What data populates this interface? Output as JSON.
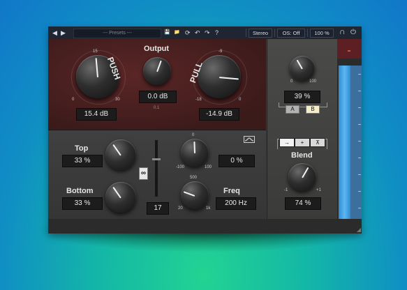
{
  "toolbar": {
    "prev_icon": "◀",
    "next_icon": "▶",
    "presets_label": "--- Presets ---",
    "save_icon": "💾",
    "folder_icon": "📁",
    "reload_icon": "⟳",
    "undo_icon": "↶",
    "redo_icon": "↷",
    "help_icon": "?",
    "stereo_label": "Stereo",
    "os_label": "OS: Off",
    "zoom_label": "100 %",
    "headphones_icon": "∩",
    "power_icon": "⏻"
  },
  "upper": {
    "push": {
      "label": "PUSH",
      "value": "15.4 dB",
      "scale_min": "0",
      "scale_mid": "15",
      "scale_max": "30"
    },
    "output": {
      "label": "Output",
      "value": "0.0 dB",
      "sublabel": "0.1"
    },
    "pull": {
      "label": "PULL",
      "value": "-14.9 dB",
      "scale_min": "-18",
      "scale_mid": "-9",
      "scale_max": "0"
    }
  },
  "lower": {
    "top": {
      "label": "Top",
      "value": "33 %"
    },
    "bottom": {
      "label": "Bottom",
      "value": "33 %"
    },
    "link_icon": "link",
    "slider_value": "17",
    "mid_knob": {
      "value": "0 %",
      "scale_top": "0",
      "scale_left": "-100",
      "scale_right": "100"
    },
    "freq": {
      "label": "Freq",
      "value": "200 Hz",
      "scale_top": "500",
      "scale_left": "20",
      "scale_right": "1k"
    },
    "curve_icon": "curve-icon"
  },
  "right": {
    "mix": {
      "value": "39 %",
      "scale_min": "0",
      "scale_max": "100"
    },
    "ab": {
      "a_label": "A",
      "b_label": "B"
    },
    "modes": {
      "m1": "→",
      "m2": "+",
      "m3": "⊼"
    },
    "blend": {
      "label": "Blend",
      "value": "74 %",
      "scale_min": "-1",
      "scale_max": "+1"
    }
  },
  "colors": {
    "upper_bg": "#4b2222",
    "lower_bg": "#3d3d3d",
    "meter_blue": "#4aa8ec",
    "toolbar_bg": "#1f2632"
  }
}
